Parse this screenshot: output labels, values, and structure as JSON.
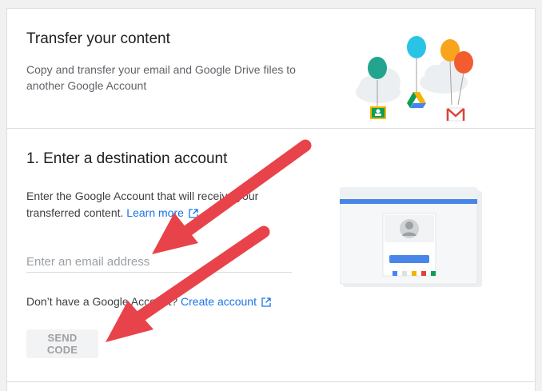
{
  "header": {
    "title": "Transfer your content",
    "subtitle": "Copy and transfer your email and Google Drive files to another Google Account"
  },
  "step1": {
    "title": "1. Enter a destination account",
    "description": "Enter the Google Account that will receive your transferred content.",
    "learn_more": "Learn more",
    "email_placeholder": "Enter an email address",
    "no_account_text": "Don’t have a Google Account?",
    "create_account": "Create account",
    "send_code": "SEND CODE"
  },
  "colors": {
    "accent": "#1a73e8",
    "annotation_arrow": "#e8434a",
    "balloon_green": "#23a48f",
    "balloon_cyan": "#29c4e5",
    "balloon_orange": "#f8a41c",
    "balloon_red": "#f25d2f"
  },
  "icons": [
    "external-link-icon",
    "google-classroom-icon",
    "google-drive-icon",
    "gmail-icon",
    "avatar-icon"
  ]
}
